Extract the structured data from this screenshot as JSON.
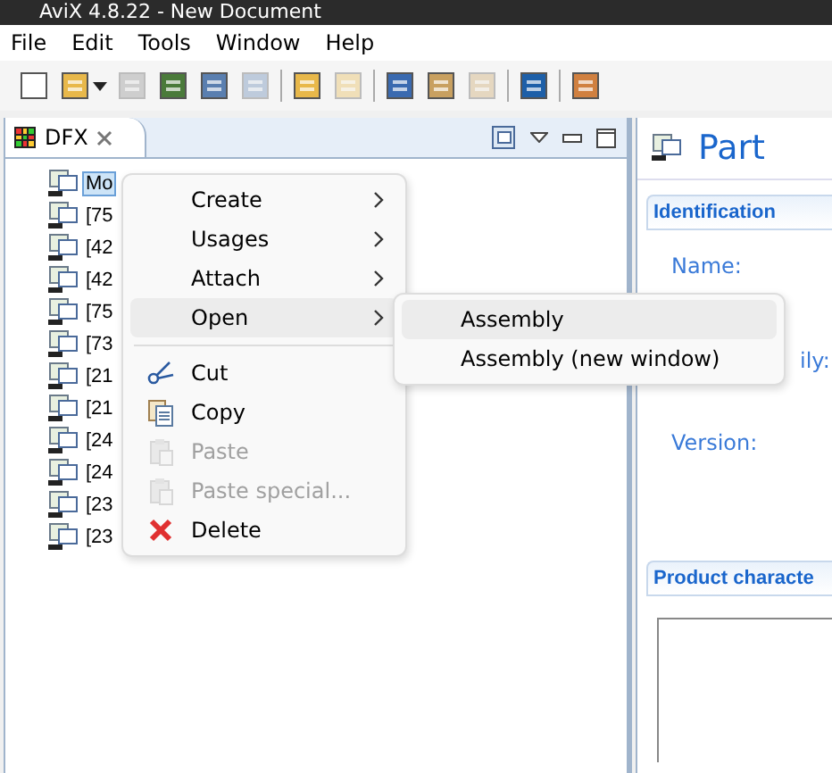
{
  "window": {
    "title": "AviX 4.8.22 - New Document"
  },
  "menu_bar": [
    "File",
    "Edit",
    "Tools",
    "Window",
    "Help"
  ],
  "toolbar": [
    {
      "kind": "new",
      "disabled": false
    },
    {
      "kind": "open",
      "disabled": false
    },
    {
      "kind": "dropdown",
      "disabled": false
    },
    {
      "kind": "folder",
      "disabled": true
    },
    {
      "kind": "save",
      "disabled": false
    },
    {
      "kind": "print",
      "disabled": false
    },
    {
      "kind": "print",
      "disabled": true
    },
    {
      "kind": "sep"
    },
    {
      "kind": "undo",
      "disabled": false
    },
    {
      "kind": "redo",
      "disabled": true
    },
    {
      "kind": "sep"
    },
    {
      "kind": "cut",
      "disabled": false
    },
    {
      "kind": "copy",
      "disabled": false
    },
    {
      "kind": "paste",
      "disabled": true
    },
    {
      "kind": "sep"
    },
    {
      "kind": "layout",
      "disabled": false
    },
    {
      "kind": "sep"
    },
    {
      "kind": "report",
      "disabled": false
    }
  ],
  "left_panel": {
    "tab": "DFX",
    "tree": [
      {
        "label": "Mo",
        "selected": true
      },
      {
        "label": "[75",
        "selected": false
      },
      {
        "label": "[42",
        "selected": false
      },
      {
        "label": "[42",
        "selected": false
      },
      {
        "label": "[75",
        "selected": false
      },
      {
        "label": "[73",
        "selected": false
      },
      {
        "label": "[21",
        "selected": false
      },
      {
        "label": "[21",
        "selected": false
      },
      {
        "label": "[24",
        "selected": false
      },
      {
        "label": "[24",
        "selected": false
      },
      {
        "label": "[23",
        "selected": false
      },
      {
        "label": "[23",
        "selected": false
      }
    ]
  },
  "context_menu": [
    {
      "label": "Create",
      "kind": "submenu",
      "selected": false,
      "disabled": false
    },
    {
      "label": "Usages",
      "kind": "submenu",
      "selected": false,
      "disabled": false
    },
    {
      "label": "Attach",
      "kind": "submenu",
      "selected": false,
      "disabled": false
    },
    {
      "label": "Open",
      "kind": "submenu",
      "selected": true,
      "disabled": false
    },
    {
      "kind": "separator"
    },
    {
      "label": "Cut",
      "kind": "cut",
      "selected": false,
      "disabled": false
    },
    {
      "label": "Copy",
      "kind": "copy",
      "selected": false,
      "disabled": false
    },
    {
      "label": "Paste",
      "kind": "paste",
      "selected": false,
      "disabled": true
    },
    {
      "label": "Paste special...",
      "kind": "paste",
      "selected": false,
      "disabled": true
    },
    {
      "label": "Delete",
      "kind": "delete",
      "selected": false,
      "disabled": false
    }
  ],
  "submenu": [
    {
      "label": "Assembly",
      "selected": true
    },
    {
      "label": "Assembly (new window)",
      "selected": false
    }
  ],
  "right_panel": {
    "title": "Part",
    "identification": {
      "header": "Identification",
      "fields": [
        "Name:",
        "ily:",
        "Version:"
      ]
    },
    "product_header": "Product characte"
  }
}
